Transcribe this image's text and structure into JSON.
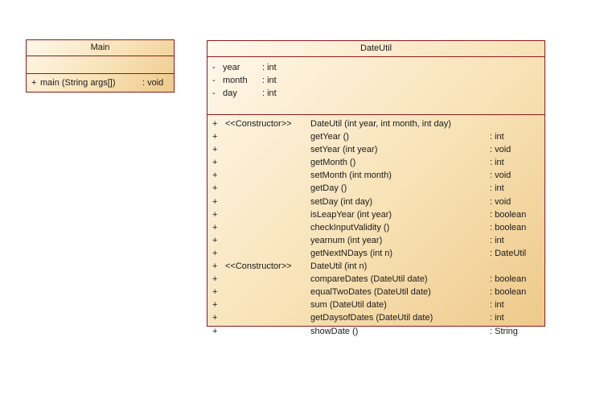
{
  "classes": {
    "main": {
      "name": "Main",
      "operations": [
        {
          "visibility": "+",
          "signature": "main (String args[])",
          "return": ": void"
        }
      ]
    },
    "dateutil": {
      "name": "DateUtil",
      "attributes": [
        {
          "visibility": "-",
          "name": "year",
          "type": ": int"
        },
        {
          "visibility": "-",
          "name": "month",
          "type": ": int"
        },
        {
          "visibility": "-",
          "name": "day",
          "type": ": int"
        }
      ],
      "operations": [
        {
          "visibility": "+",
          "stereotype": "<<Constructor>>",
          "signature": "DateUtil (int year, int month, int day)",
          "return": ""
        },
        {
          "visibility": "+",
          "stereotype": "",
          "signature": "getYear ()",
          "return": ": int"
        },
        {
          "visibility": "+",
          "stereotype": "",
          "signature": "setYear (int year)",
          "return": ": void"
        },
        {
          "visibility": "+",
          "stereotype": "",
          "signature": "getMonth ()",
          "return": ": int"
        },
        {
          "visibility": "+",
          "stereotype": "",
          "signature": "setMonth (int month)",
          "return": ": void"
        },
        {
          "visibility": "+",
          "stereotype": "",
          "signature": "getDay ()",
          "return": ": int"
        },
        {
          "visibility": "+",
          "stereotype": "",
          "signature": "setDay (int day)",
          "return": ": void"
        },
        {
          "visibility": "+",
          "stereotype": "",
          "signature": "isLeapYear (int year)",
          "return": ": boolean"
        },
        {
          "visibility": "+",
          "stereotype": "",
          "signature": "checkInputValidity ()",
          "return": ": boolean"
        },
        {
          "visibility": "+",
          "stereotype": "",
          "signature": "yearnum (int year)",
          "return": ": int"
        },
        {
          "visibility": "+",
          "stereotype": "",
          "signature": "getNextNDays (int n)",
          "return": ": DateUtil"
        },
        {
          "visibility": "+",
          "stereotype": "<<Constructor>>",
          "signature": "DateUtil (int n)",
          "return": ""
        },
        {
          "visibility": "+",
          "stereotype": "",
          "signature": "compareDates (DateUtil date)",
          "return": ": boolean"
        },
        {
          "visibility": "+",
          "stereotype": "",
          "signature": "equalTwoDates (DateUtil date)",
          "return": ": boolean"
        },
        {
          "visibility": "+",
          "stereotype": "",
          "signature": "sum (DateUtil date)",
          "return": ": int"
        },
        {
          "visibility": "+",
          "stereotype": "",
          "signature": "getDaysofDates (DateUtil date)",
          "return": ": int"
        },
        {
          "visibility": "+",
          "stereotype": "",
          "signature": "showDate ()",
          "return": ": String"
        }
      ]
    }
  },
  "colors": {
    "border": "#8b1a1a",
    "fill_light": "#fff8ec",
    "fill_dark": "#eec98a"
  }
}
